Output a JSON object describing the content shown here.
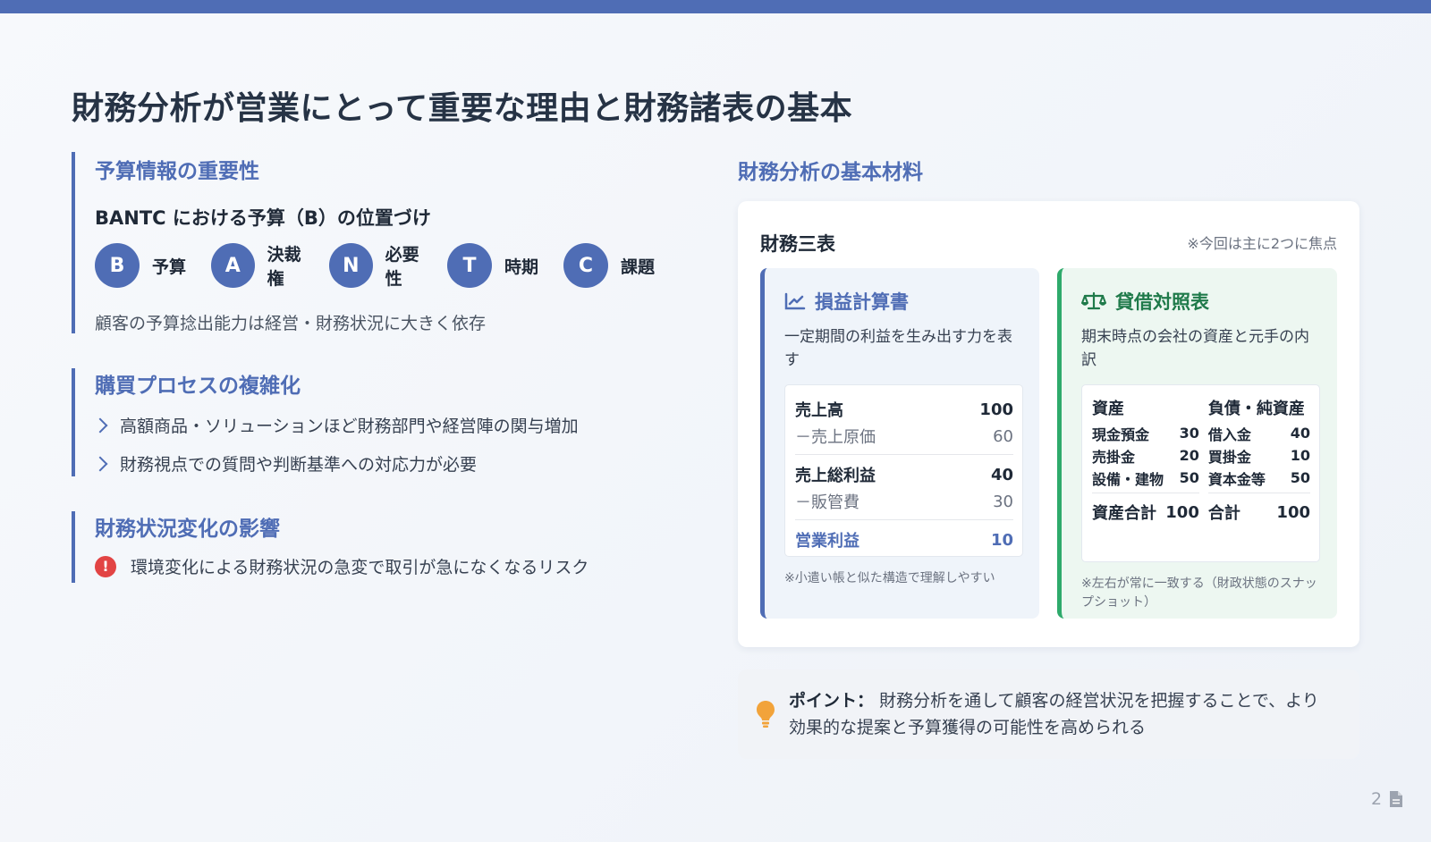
{
  "title": "財務分析が営業にとって重要な理由と財務諸表の基本",
  "left": {
    "sec1": {
      "heading": "予算情報の重要性",
      "subheading": "BANTC における予算（B）の位置づけ",
      "bantc": [
        {
          "letter": "B",
          "label": "予算"
        },
        {
          "letter": "A",
          "label": "決裁権"
        },
        {
          "letter": "N",
          "label": "必要性"
        },
        {
          "letter": "T",
          "label": "時期"
        },
        {
          "letter": "C",
          "label": "課題"
        }
      ],
      "note": "顧客の予算捻出能力は経営・財務状況に大きく依存"
    },
    "sec2": {
      "heading": "購買プロセスの複雑化",
      "bullets": [
        "高額商品・ソリューションほど財務部門や経営陣の関与増加",
        "財務視点での質問や判断基準への対応力が必要"
      ]
    },
    "sec3": {
      "heading": "財務状況変化の影響",
      "risk_icon": "!",
      "risk": "環境変化による財務状況の急変で取引が急になくなるリスク"
    }
  },
  "right": {
    "heading": "財務分析の基本材料",
    "card_title": "財務三表",
    "card_note": "※今回は主に2つに焦点",
    "pl": {
      "icon": "chart-line-icon",
      "title": "損益計算書",
      "desc": "一定期間の利益を生み出す力を表す",
      "rows": [
        {
          "label": "売上高",
          "value": "100"
        },
        {
          "label": "－売上原価",
          "value": "60"
        },
        {
          "label": "売上総利益",
          "value": "40"
        },
        {
          "label": "－販管費",
          "value": "30"
        },
        {
          "label": "営業利益",
          "value": "10"
        }
      ],
      "foot": "※小遣い帳と似た構造で理解しやすい"
    },
    "bs": {
      "icon": "scale-icon",
      "title": "貸借対照表",
      "desc": "期末時点の会社の資産と元手の内訳",
      "assets_header": "資産",
      "assets": [
        {
          "label": "現金預金",
          "value": "30"
        },
        {
          "label": "売掛金",
          "value": "20"
        },
        {
          "label": "設備・建物",
          "value": "50"
        }
      ],
      "assets_total_label": "資産合計",
      "assets_total_value": "100",
      "liab_header": "負債・純資産",
      "liabilities": [
        {
          "label": "借入金",
          "value": "40"
        },
        {
          "label": "買掛金",
          "value": "10"
        },
        {
          "label": "資本金等",
          "value": "50"
        }
      ],
      "liab_total_label": "合計",
      "liab_total_value": "100",
      "foot": "※左右が常に一致する（財政状態のスナップショット）"
    }
  },
  "point": {
    "icon": "lightbulb-icon",
    "label": "ポイント：",
    "text": "財務分析を通して顧客の経営状況を把握することで、より効果的な提案と予算獲得の可能性を高められる"
  },
  "page_number": "2",
  "colors": {
    "accent": "#4f6db5",
    "green": "#2eaa6b",
    "risk": "#e24444",
    "bulb": "#f2a33a"
  }
}
